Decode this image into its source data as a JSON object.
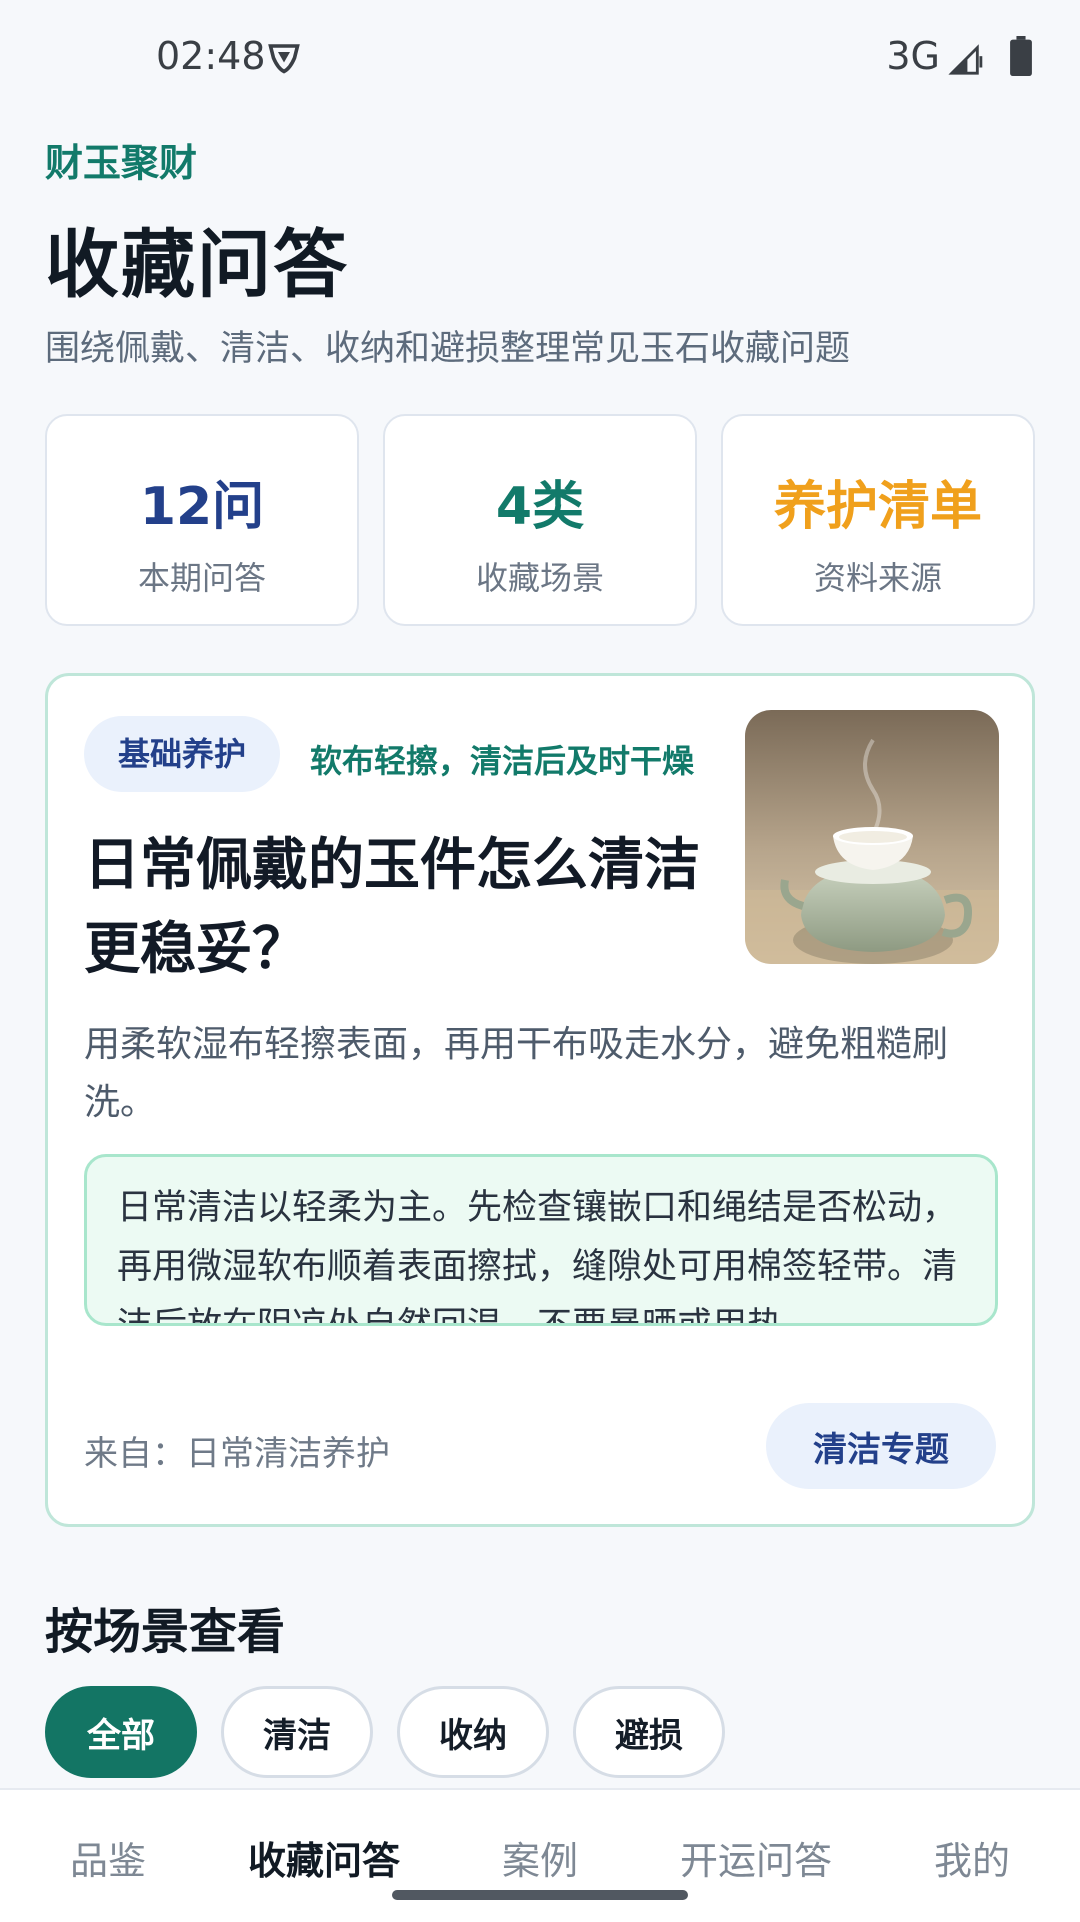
{
  "status_bar": {
    "time": "02:48",
    "network": "3G"
  },
  "header": {
    "brand": "财玉聚财",
    "title": "收藏问答",
    "subtitle": "围绕佩戴、清洁、收纳和避损整理常见玉石收藏问题"
  },
  "stats": [
    {
      "value": "12问",
      "label": "本期问答",
      "color": "#23408a"
    },
    {
      "value": "4类",
      "label": "收藏场景",
      "color": "#127a6a"
    },
    {
      "value": "养护清单",
      "label": "资料来源",
      "color": "#f0a01c"
    }
  ],
  "qa_card": {
    "tag": "基础养护",
    "hint": "软布轻擦，清洁后及时干燥",
    "question": "日常佩戴的玉件怎么清洁更稳妥？",
    "summary": "用柔软湿布轻擦表面，再用干布吸走水分，避免粗糙刷洗。",
    "detail": "日常清洁以轻柔为主。先检查镶嵌口和绳结是否松动，再用微湿软布顺着表面擦拭，缝隙处可用棉签轻带。清洁后放在阴凉处自然回温，不要暴晒或用热…",
    "source": "来自：日常清洁养护",
    "action_label": "清洁专题"
  },
  "scenes": {
    "title": "按场景查看",
    "chips": [
      "全部",
      "清洁",
      "收纳",
      "避损"
    ],
    "active_index": 0
  },
  "bottom_nav": {
    "tabs": [
      "品鉴",
      "收藏问答",
      "案例",
      "开运问答",
      "我的"
    ],
    "active_index": 1
  }
}
